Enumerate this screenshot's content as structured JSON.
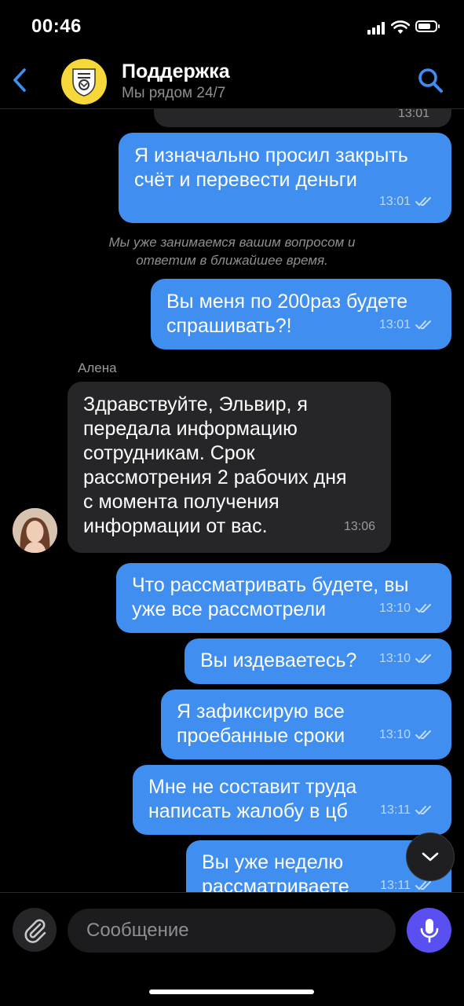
{
  "status_bar": {
    "time": "00:46"
  },
  "header": {
    "title": "Поддержка",
    "subtitle": "Мы рядом 24/7"
  },
  "chat": {
    "top_partial_time": "13:01",
    "messages": [
      {
        "direction": "out",
        "lines": [
          "Я изначально просил закрыть",
          "счёт и перевести деньги"
        ],
        "time": "13:01"
      },
      {
        "direction": "system",
        "lines": [
          "Мы уже занимаемся вашим вопросом и",
          "ответим в ближайшее время."
        ]
      },
      {
        "direction": "out",
        "lines": [
          "Вы меня по 200раз будете",
          "спрашивать?!"
        ],
        "time": "13:01"
      },
      {
        "direction": "in",
        "sender": "Алена",
        "lines": [
          "Здравствуйте, Эльвир, я",
          "передала информацию",
          "сотрудникам. Срок",
          "рассмотрения 2 рабочих дня",
          "с момента получения",
          "информации от вас."
        ],
        "time": "13:06"
      },
      {
        "direction": "out",
        "lines": [
          "Что рассматривать будете, вы",
          "уже все рассмотрели"
        ],
        "time": "13:10"
      },
      {
        "direction": "out",
        "lines": [
          "Вы издеваетесь?"
        ],
        "time": "13:10"
      },
      {
        "direction": "out",
        "lines": [
          "Я зафиксирую все",
          "проебанные сроки"
        ],
        "time": "13:10"
      },
      {
        "direction": "out",
        "lines": [
          "Мне не составит труда",
          "написать жалобу в цб"
        ],
        "time": "13:11"
      },
      {
        "direction": "out",
        "lines": [
          "Вы уже неделю",
          "рассматриваете"
        ],
        "time": "13:11"
      }
    ]
  },
  "composer": {
    "placeholder": "Сообщение"
  },
  "icons": {
    "back": "chevron-left-icon",
    "search": "search-icon",
    "attach": "paperclip-icon",
    "mic": "microphone-icon",
    "scroll": "chevron-down-icon",
    "read": "double-check-icon"
  },
  "colors": {
    "outgoing_bubble": "#3f8ef0",
    "incoming_bubble": "#262628",
    "accent": "#3f8ef0",
    "mic": "#5a4ff0",
    "logo": "#f7d83b"
  }
}
